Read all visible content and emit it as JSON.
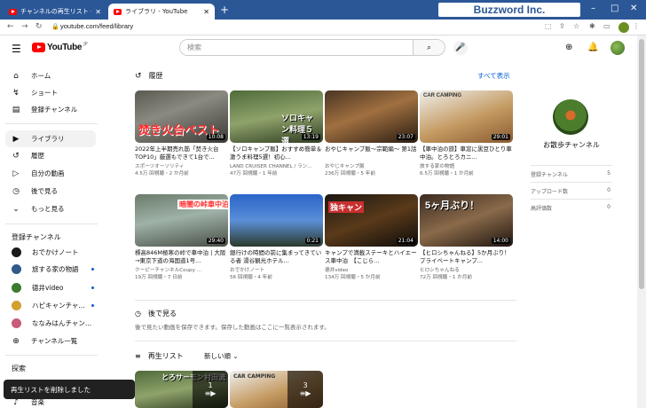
{
  "browser": {
    "tabs": [
      {
        "title": "チャンネルの再生リスト - YouTube S"
      },
      {
        "title": "ライブラリ - YouTube"
      }
    ],
    "url": "youtube.com/feed/library",
    "brand": "Buzzword Inc."
  },
  "header": {
    "logo_text": "YouTube",
    "logo_region": "JP",
    "search_placeholder": "検索"
  },
  "sidebar": {
    "main": [
      {
        "label": "ホーム",
        "icon": "home-icon"
      },
      {
        "label": "ショート",
        "icon": "shorts-icon"
      },
      {
        "label": "登録チャンネル",
        "icon": "subscriptions-icon"
      }
    ],
    "library": [
      {
        "label": "ライブラリ",
        "icon": "library-icon"
      },
      {
        "label": "履歴",
        "icon": "history-icon"
      },
      {
        "label": "自分の動画",
        "icon": "my-videos-icon"
      },
      {
        "label": "後で見る",
        "icon": "watch-later-icon"
      },
      {
        "label": "もっと見る",
        "icon": "chevron-down-icon"
      }
    ],
    "subs_heading": "登録チャンネル",
    "subs": [
      {
        "label": "おでかけノート",
        "color": "#1a1a1a"
      },
      {
        "label": "旅する家の物語",
        "color": "#2f5a8a"
      },
      {
        "label": "德井video",
        "color": "#3c7a2c"
      },
      {
        "label": "ハピキャンチャ...",
        "color": "#d0a030"
      },
      {
        "label": "ななみはんチャン...",
        "color": "#c85a7a"
      }
    ],
    "subs_more": "チャンネル一覧",
    "explore_heading": "探索",
    "explore_item": "音楽"
  },
  "history": {
    "title": "履歴",
    "see_all": "すべて表示",
    "videos": [
      {
        "title": "2022年上半期売れ筋「焚き火台TOP10」厳選もできて1台で...",
        "channel": "スポーツオーソリティ",
        "meta": "4.5万 回視聴・2 か月前",
        "duration": "10:08",
        "overlay": "焚き火台ベスト"
      },
      {
        "title": "【ソロキャンプ飯】おすすめ簡単＆激うま料理5選！初心...",
        "channel": "LAND CRUISER CHANNEL / ラン...",
        "meta": "47万 回視聴・1 年前",
        "duration": "13:19",
        "overlay": "ソロキャン料理５選"
      },
      {
        "title": "おやじキャンプ飯〜宗範編〜 第1話",
        "channel": "おやじキャンプ飯",
        "meta": "236万 回視聴・5 年前",
        "duration": "23:07",
        "overlay": ""
      },
      {
        "title": "【車中泊の旅】車窓に黒豆ひとり車中泊。とろとろカニ...",
        "channel": "旅する家の物語",
        "meta": "6.5万 回視聴・1 か月前",
        "duration": "29:01",
        "overlay": "CAR CAMPING"
      },
      {
        "title": "標高846M極寒の峠で車中泊 | 大阪→東京下道の海国道1号...",
        "channel": "クーピーチャンネルCoupy ...",
        "meta": "19万 回視聴・7 日前",
        "duration": "29:40",
        "overlay": "暗闇の峠車中泊"
      },
      {
        "title": "銀行けの時間の前に集まってきている者 湯谷観光ホテル...",
        "channel": "おでかけノート",
        "meta": "56 回視聴・4 年前",
        "duration": "0:21",
        "overlay": ""
      },
      {
        "title": "キャンプで満載ステーキとハイエース車中泊　【こじら...",
        "channel": "德井video",
        "meta": "134万 回視聴・5 か月前",
        "duration": "21:04",
        "overlay": "独キャン"
      },
      {
        "title": "【ヒロシちゃんねる】5か月ぶり！プライベートキャンプ...",
        "channel": "ヒロシちゃんねる",
        "meta": "72万 回視聴・1 か月前",
        "duration": "14:00",
        "overlay": "5ヶ月ぶり！"
      }
    ]
  },
  "watch_later": {
    "title": "後で見る",
    "description": "後で見たい動画を保存できます。保存した動画はここに一覧表示されます。"
  },
  "playlists": {
    "title": "再生リスト",
    "sort": "新しい順",
    "items": [
      {
        "count": "1",
        "overlay": "とろサーモン村田流"
      },
      {
        "count": "3",
        "overlay": "CAR CAMPING"
      }
    ]
  },
  "profile": {
    "name": "お散歩チャンネル",
    "stats": [
      {
        "label": "登録チャンネル",
        "value": "5"
      },
      {
        "label": "アップロード数",
        "value": "0"
      },
      {
        "label": "高評価数",
        "value": "0"
      }
    ]
  },
  "toast": "再生リストを削除しました"
}
